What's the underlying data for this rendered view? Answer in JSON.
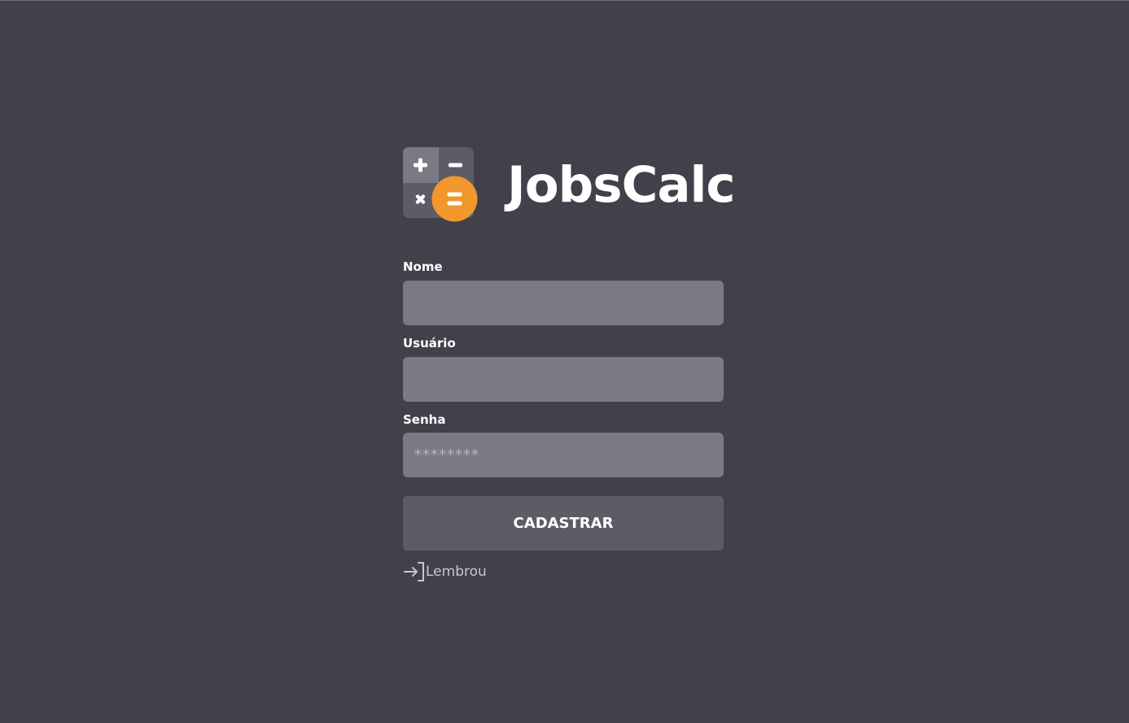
{
  "brand": {
    "name": "JobsCalc",
    "logo_icon": "calculator-icon",
    "accent_color": "#f1972c"
  },
  "form": {
    "name_label": "Nome",
    "name_placeholder": "",
    "user_label": "Usuário",
    "user_placeholder": "",
    "password_label": "Senha",
    "password_placeholder": "********",
    "submit_label": "CADASTRAR"
  },
  "footer": {
    "back_link_label": "Lembrou",
    "back_link_icon": "sign-in-icon"
  }
}
